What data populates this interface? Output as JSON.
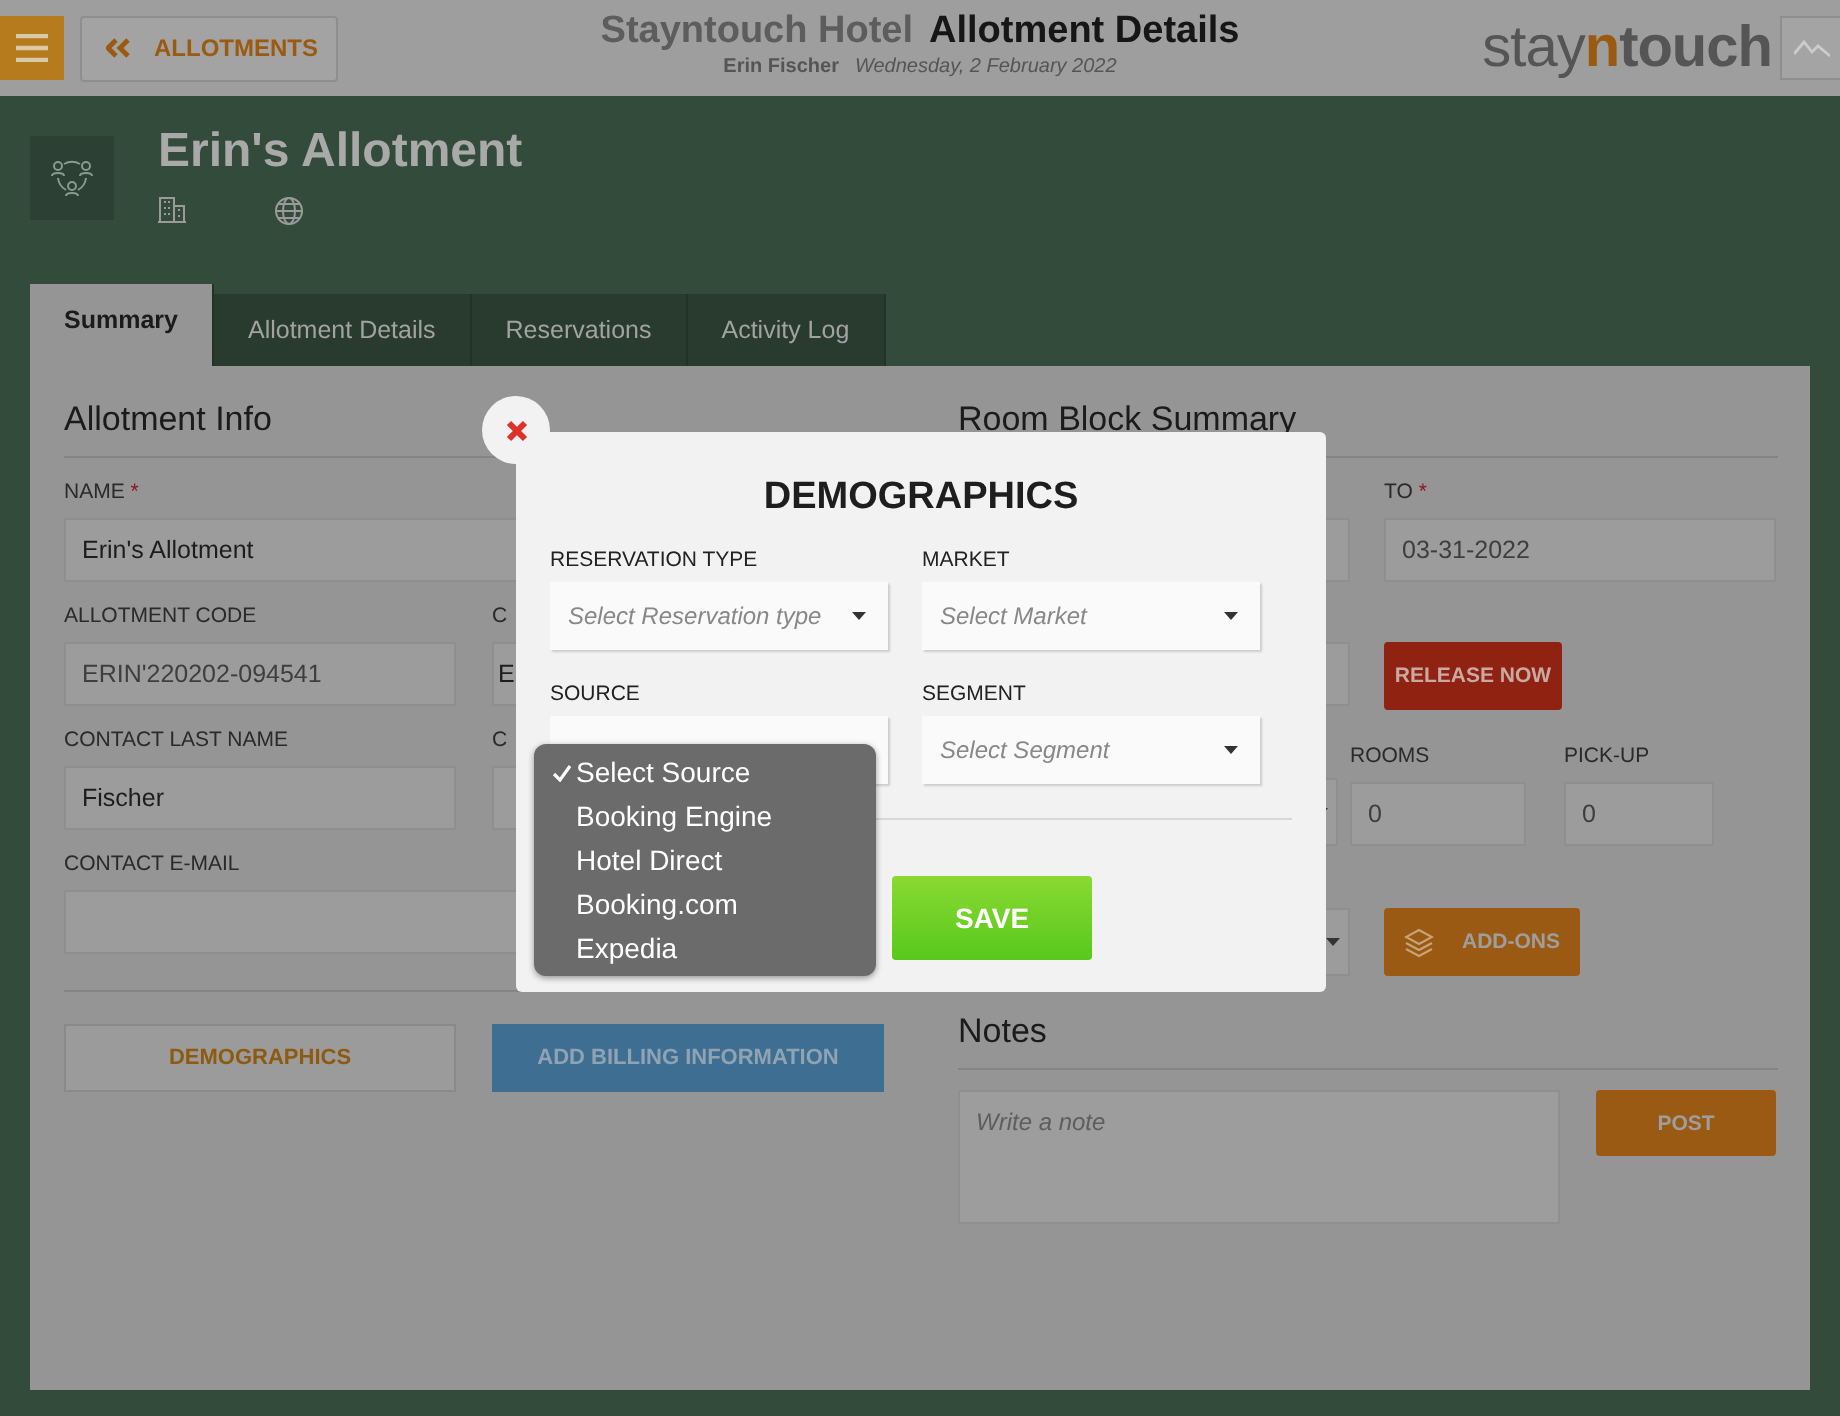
{
  "header": {
    "back_label": "ALLOTMENTS",
    "hotel": "Stayntouch Hotel",
    "page_title": "Allotment Details",
    "user": "Erin Fischer",
    "date": "Wednesday, 2 February 2022",
    "logo": [
      {
        "text": "stay",
        "accent": false
      },
      {
        "text": "n",
        "accent": true
      },
      {
        "text": "touch",
        "accent": false
      }
    ]
  },
  "allotment": {
    "title": "Erin's Allotment"
  },
  "tabs": [
    {
      "label": "Summary",
      "selected": true
    },
    {
      "label": "Allotment Details",
      "selected": false
    },
    {
      "label": "Reservations",
      "selected": false
    },
    {
      "label": "Activity Log",
      "selected": false
    }
  ],
  "allotment_info": {
    "heading": "Allotment Info",
    "rows": [
      [
        {
          "label": "NAME",
          "required_mark": "*",
          "value": "Erin's Allotment",
          "wide": true
        }
      ],
      [
        {
          "label": "ALLOTMENT CODE",
          "value": "ERIN'220202-094541",
          "readonly": true,
          "wide": false
        },
        {
          "label": "C",
          "value": "E",
          "readonly": false,
          "wide": false
        }
      ],
      [
        {
          "label": "CONTACT LAST NAME",
          "value": "Fischer",
          "readonly": false,
          "wide": false
        },
        {
          "label": "C",
          "wide": false
        }
      ],
      [
        {
          "label": "CONTACT E-MAIL",
          "wide": true
        }
      ]
    ],
    "buttons": [
      {
        "label": "DEMOGRAPHICS",
        "kind": "plain"
      },
      {
        "label": "ADD BILLING INFORMATION",
        "kind": "blue"
      }
    ]
  },
  "room_block": {
    "heading": "Room Block Summary",
    "to_label": "TO",
    "to_required_mark": "*",
    "to_value": "03-31-2022",
    "release_button": "RELEASE NOW",
    "rooms_label": "ROOMS",
    "rooms_value": "0",
    "pickup_label": "PICK-UP",
    "pickup_value": "0",
    "addons_button": "ADD-ONS"
  },
  "notes": {
    "heading": "Notes",
    "placeholder": "Write a note",
    "post_button": "POST"
  },
  "modal": {
    "title": "DEMOGRAPHICS",
    "fields": [
      {
        "label": "RESERVATION TYPE",
        "placeholder": "Select Reservation type"
      },
      {
        "label": "MARKET",
        "placeholder": "Select Market"
      },
      {
        "label": "SOURCE"
      },
      {
        "label": "SEGMENT",
        "placeholder": "Select Segment"
      }
    ],
    "save_button": "SAVE",
    "source_options": [
      {
        "label": "Select Source",
        "selected": true
      },
      {
        "label": "Booking Engine",
        "selected": false
      },
      {
        "label": "Hotel Direct",
        "selected": false
      },
      {
        "label": "Booking.com",
        "selected": false
      },
      {
        "label": "Expedia",
        "selected": false
      }
    ]
  }
}
